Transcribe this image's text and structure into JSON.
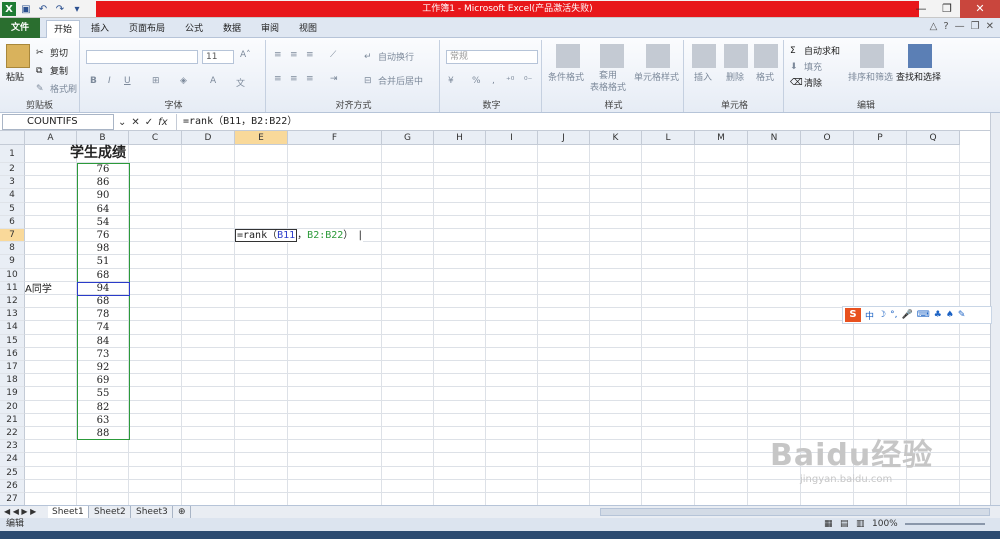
{
  "window": {
    "title": "工作簿1 - Microsoft Excel(产品激活失败)",
    "controls": [
      "—",
      "❐",
      "✕"
    ]
  },
  "ribbon_tabs": [
    "文件",
    "开始",
    "插入",
    "页面布局",
    "公式",
    "数据",
    "审阅",
    "视图"
  ],
  "ribbon": {
    "clipboard": {
      "label": "剪贴板",
      "paste": "粘贴",
      "cut": "剪切",
      "copy": "复制",
      "format_painter": "格式刷"
    },
    "font": {
      "label": "字体",
      "size": "11",
      "bold": "B",
      "italic": "I",
      "underline": "U"
    },
    "alignment": {
      "label": "对齐方式",
      "wrap": "自动换行",
      "merge": "合并后居中"
    },
    "number": {
      "label": "数字",
      "format": "常规",
      "percent": "%",
      "comma": ","
    },
    "styles": {
      "label": "样式",
      "conditional": "条件格式",
      "table": "套用\n表格格式",
      "cell_styles": "单元格样式"
    },
    "cells": {
      "label": "单元格",
      "insert": "插入",
      "delete": "删除",
      "format": "格式"
    },
    "editing": {
      "label": "编辑",
      "autosum": "自动求和",
      "fill": "填充",
      "clear": "清除",
      "sort": "排序和筛选",
      "find": "查找和选择"
    }
  },
  "formula_bar": {
    "name_box": "COUNTIFS",
    "formula": "=rank（B11，B2:B22）"
  },
  "columns": [
    "A",
    "B",
    "C",
    "D",
    "E",
    "F",
    "G",
    "H",
    "I",
    "J",
    "K",
    "L",
    "M",
    "N",
    "O",
    "P",
    "Q"
  ],
  "rows": [
    "1",
    "2",
    "3",
    "4",
    "5",
    "6",
    "7",
    "8",
    "9",
    "10",
    "11",
    "12",
    "13",
    "14",
    "15",
    "16",
    "17",
    "18",
    "19",
    "20",
    "21",
    "22",
    "23",
    "24",
    "25",
    "26",
    "27"
  ],
  "cells": {
    "B1": "学生成绩",
    "A11": "A同学",
    "E7_formula_text": "=rank（",
    "E7_ref1": "B11",
    "E7_sep": "，",
    "E7_ref2": "B2:B22",
    "E7_close": "）",
    "scores": [
      "76",
      "86",
      "90",
      "64",
      "54",
      "76",
      "98",
      "51",
      "68",
      "94",
      "68",
      "78",
      "74",
      "84",
      "73",
      "92",
      "69",
      "55",
      "82",
      "63",
      "88"
    ]
  },
  "sheets": [
    "Sheet1",
    "Sheet2",
    "Sheet3"
  ],
  "status": {
    "mode": "编辑",
    "zoom": "100%"
  },
  "ime": {
    "logo": "S",
    "lang": "中"
  },
  "watermark": {
    "brand": "Baidu经验",
    "url": "jingyan.baidu.com"
  }
}
